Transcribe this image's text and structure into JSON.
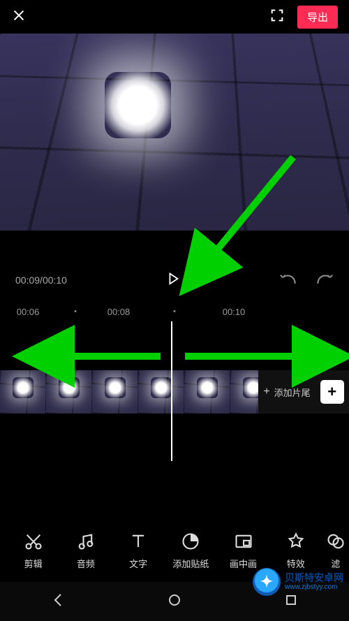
{
  "topbar": {
    "export_label": "导出"
  },
  "time": {
    "current": "00:09",
    "total": "00:10"
  },
  "ruler": {
    "ticks": [
      "00:06",
      "00:08",
      "00:10"
    ]
  },
  "strip": {
    "add_end_label": "添加片尾",
    "add_clip_glyph": "+"
  },
  "tools": [
    {
      "id": "cut",
      "label": "剪辑",
      "icon": "scissors-icon"
    },
    {
      "id": "audio",
      "label": "音频",
      "icon": "music-note-icon"
    },
    {
      "id": "text",
      "label": "文字",
      "icon": "text-icon"
    },
    {
      "id": "sticker",
      "label": "添加贴纸",
      "icon": "sticker-icon"
    },
    {
      "id": "pip",
      "label": "画中画",
      "icon": "pip-icon"
    },
    {
      "id": "effect",
      "label": "特效",
      "icon": "star-icon"
    },
    {
      "id": "filter",
      "label": "滤",
      "icon": "filter-icon"
    }
  ],
  "watermark": {
    "title": "贝斯特安卓网",
    "url": "www.zjbstyy.com"
  }
}
